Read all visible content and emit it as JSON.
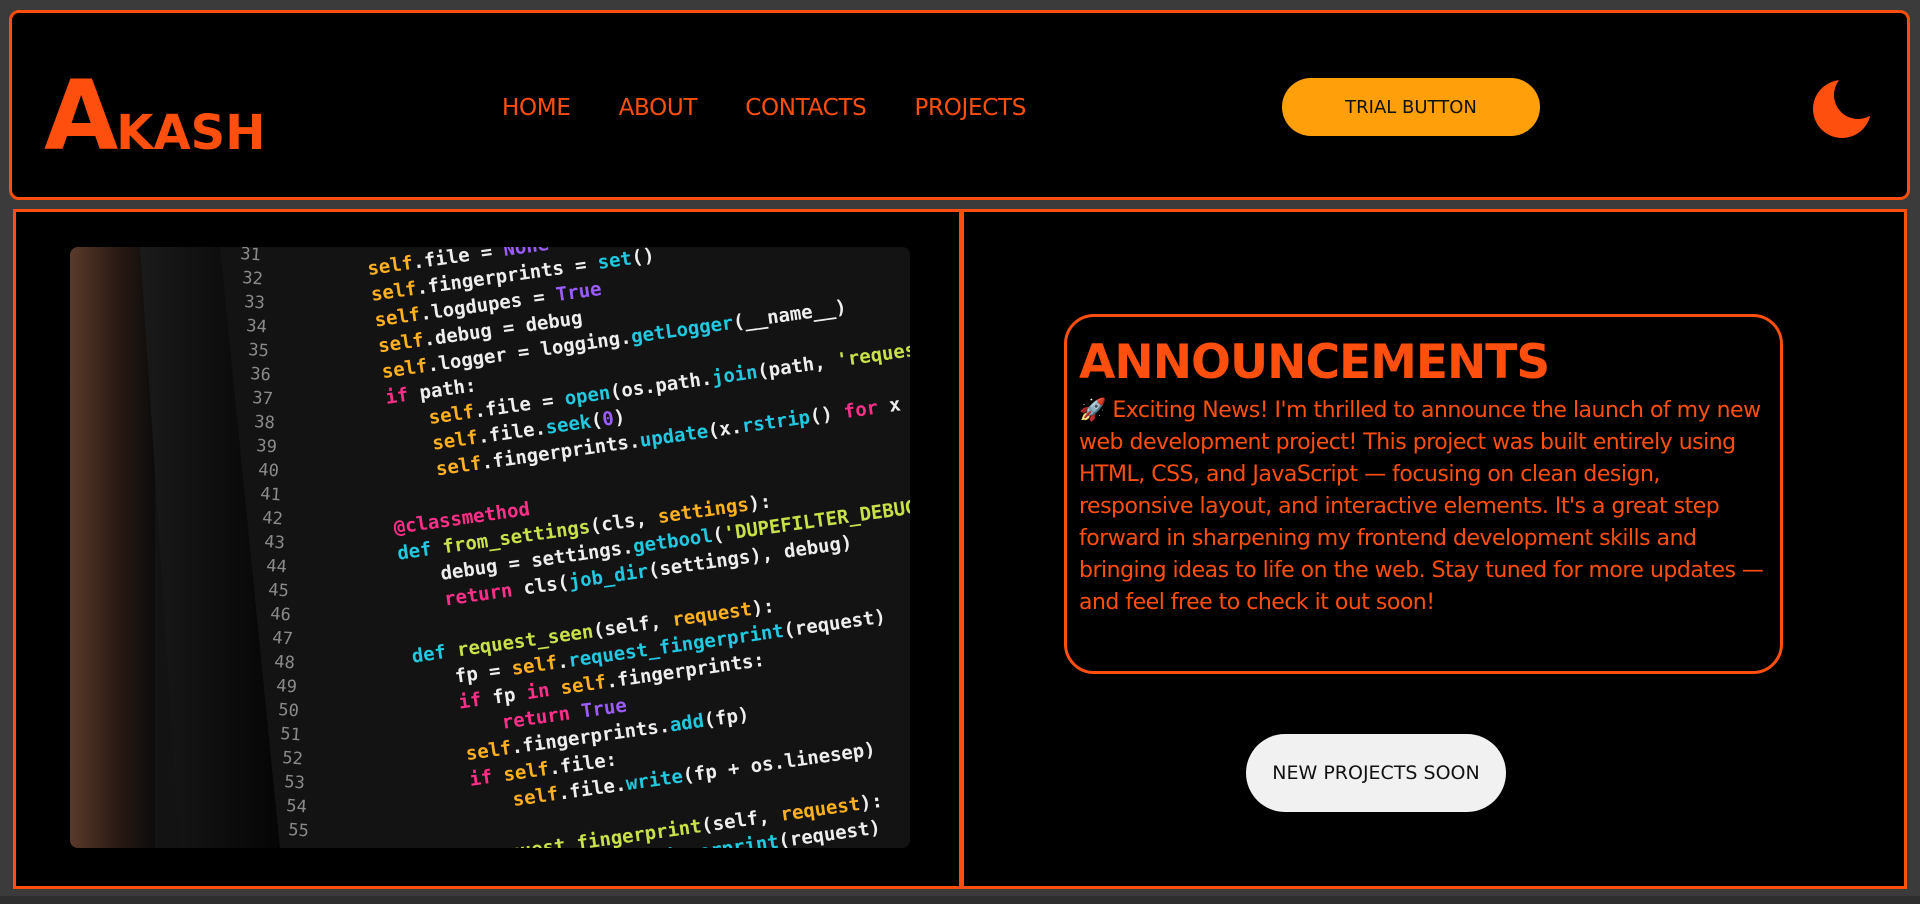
{
  "header": {
    "logo_initial": "A",
    "logo_rest": "KASH",
    "nav": [
      {
        "label": "HOME"
      },
      {
        "label": "ABOUT"
      },
      {
        "label": "CONTACTS"
      },
      {
        "label": "PROJECTS"
      }
    ],
    "trial_button": "TRIAL BUTTON",
    "theme_icon": "moon-icon"
  },
  "main": {
    "image_icon": "code-screenshot",
    "announcement": {
      "title": "ANNOUNCEMENTS",
      "body": "🚀 Exciting News! I'm thrilled to announce the launch of my new web development project! This project was built entirely using HTML, CSS, and JavaScript — focusing on clean design, responsive layout, and interactive elements. It's a great step forward in sharpening my frontend development skills and bringing ideas to life on the web. Stay tuned for more updates — and feel free to check it out soon!"
    },
    "projects_button": "NEW PROJECTS SOON"
  },
  "colors": {
    "accent": "#ff4f0f",
    "trial_button_bg": "#ffa00a",
    "background": "#000000",
    "soon_button_bg": "#f1f1f1"
  }
}
